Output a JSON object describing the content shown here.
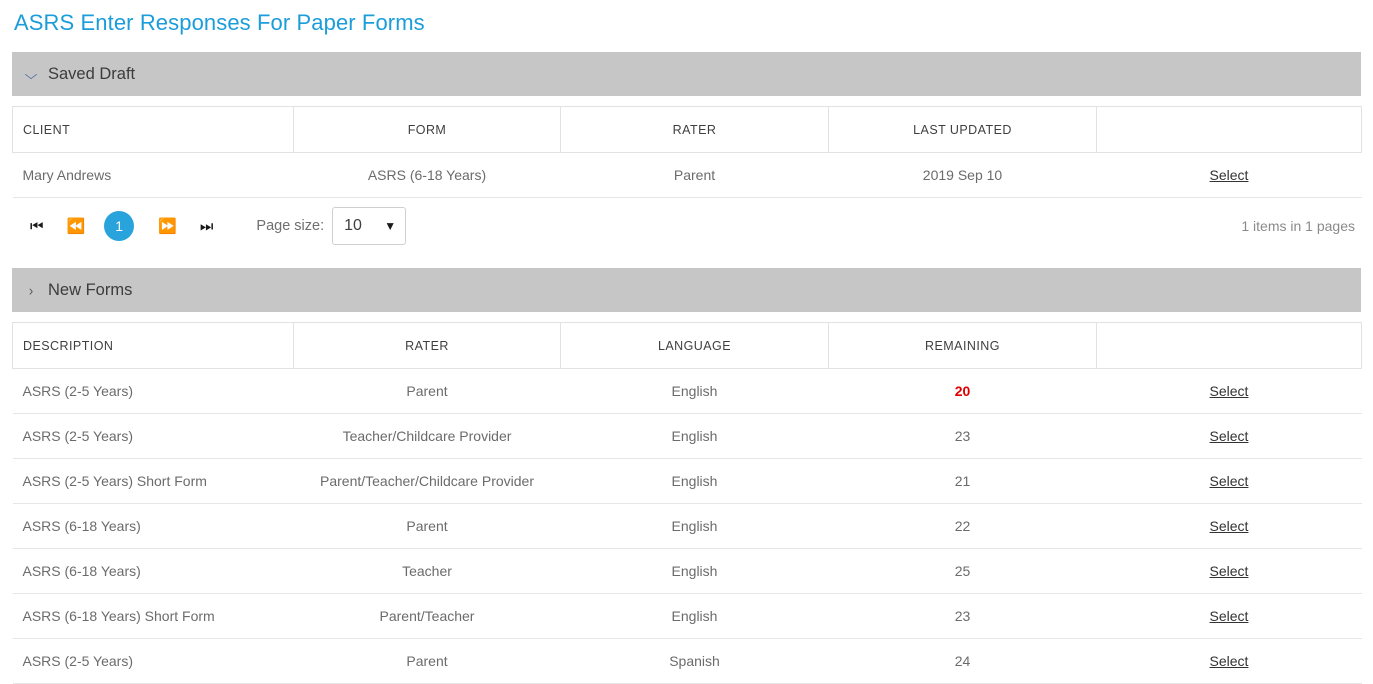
{
  "page": {
    "title": "ASRS Enter Responses For Paper Forms",
    "title_color": "#1b9dd9"
  },
  "saved_draft": {
    "label": "Saved Draft",
    "chevron": "chevron-down-icon",
    "expanded": true,
    "columns": [
      "CLIENT",
      "FORM",
      "RATER",
      "LAST UPDATED",
      ""
    ],
    "rows": [
      {
        "client": "Mary Andrews",
        "form": "ASRS (6-18 Years)",
        "rater": "Parent",
        "last_updated": "2019 Sep 10",
        "action": "Select"
      }
    ],
    "pager": {
      "first": "⏮",
      "prev": "⏪",
      "current_page": "1",
      "next": "⏩",
      "last": "⏭",
      "page_size_label": "Page size:",
      "page_size_value": "10",
      "caret": "▼",
      "info": "1 items in 1 pages"
    }
  },
  "new_forms": {
    "label": "New Forms",
    "chevron": "chevron-right-icon",
    "expanded": false,
    "columns": [
      "DESCRIPTION",
      "RATER",
      "LANGUAGE",
      "REMAINING",
      ""
    ],
    "rows": [
      {
        "description": "ASRS (2-5 Years)",
        "rater": "Parent",
        "language": "English",
        "remaining": "20",
        "remaining_low": true,
        "action": "Select"
      },
      {
        "description": "ASRS (2-5 Years)",
        "rater": "Teacher/Childcare Provider",
        "language": "English",
        "remaining": "23",
        "remaining_low": false,
        "action": "Select"
      },
      {
        "description": "ASRS (2-5 Years) Short Form",
        "rater": "Parent/Teacher/Childcare Provider",
        "language": "English",
        "remaining": "21",
        "remaining_low": false,
        "action": "Select"
      },
      {
        "description": "ASRS (6-18 Years)",
        "rater": "Parent",
        "language": "English",
        "remaining": "22",
        "remaining_low": false,
        "action": "Select"
      },
      {
        "description": "ASRS (6-18 Years)",
        "rater": "Teacher",
        "language": "English",
        "remaining": "25",
        "remaining_low": false,
        "action": "Select"
      },
      {
        "description": "ASRS (6-18 Years) Short Form",
        "rater": "Parent/Teacher",
        "language": "English",
        "remaining": "23",
        "remaining_low": false,
        "action": "Select"
      },
      {
        "description": "ASRS (2-5 Years)",
        "rater": "Parent",
        "language": "Spanish",
        "remaining": "24",
        "remaining_low": false,
        "action": "Select"
      }
    ]
  },
  "colors": {
    "accent": "#1b9dd9",
    "section_bar": "#c6c6c6",
    "page_badge": "#29a3dc",
    "low_count": "#e00000"
  }
}
